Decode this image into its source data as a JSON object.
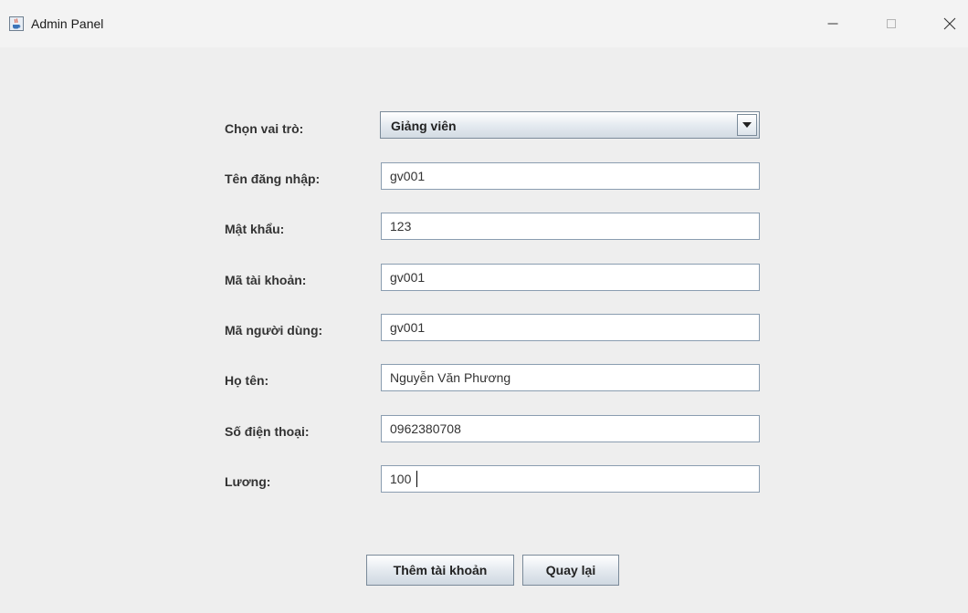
{
  "window": {
    "title": "Admin Panel",
    "icon": "java-cup-icon"
  },
  "form": {
    "role": {
      "label": "Chọn vai trò:",
      "selected": "Giảng viên"
    },
    "fields": [
      {
        "label": "Tên đăng nhập:",
        "value": "gv001"
      },
      {
        "label": "Mật khẩu:",
        "value": "123"
      },
      {
        "label": "Mã tài khoản:",
        "value": "gv001"
      },
      {
        "label": "Mã người dùng:",
        "value": "gv001"
      },
      {
        "label": "Họ tên:",
        "value": "Nguyễn Văn Phương"
      },
      {
        "label": "Số điện thoại:",
        "value": "0962380708"
      },
      {
        "label": "Lương:",
        "value": "100"
      }
    ]
  },
  "buttons": {
    "add": "Thêm tài khoản",
    "back": "Quay lại"
  }
}
